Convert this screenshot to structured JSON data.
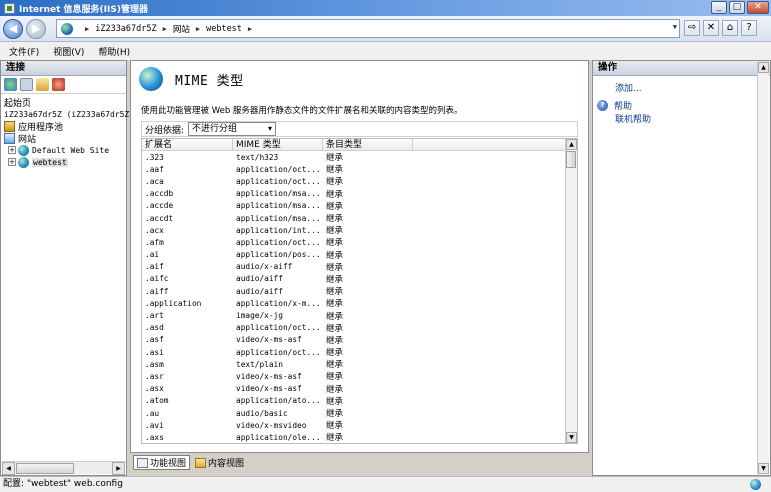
{
  "window": {
    "title": "Internet 信息服务(IIS)管理器"
  },
  "address": {
    "crumbs": [
      "iZ233a67dr5Z",
      "网站",
      "webtest"
    ]
  },
  "menu": {
    "items": [
      "文件(F)",
      "视图(V)",
      "帮助(H)"
    ]
  },
  "connections": {
    "header": "连接",
    "tree": {
      "start_page": "起始页",
      "server": "iZ233a67dr5Z (iZ233a67dr5Z\\",
      "app_pools": "应用程序池",
      "sites": "网站",
      "site1": "Default Web Site",
      "site2": "webtest"
    }
  },
  "main": {
    "title": "MIME 类型",
    "description": "使用此功能管理被 Web 服务器用作静态文件的文件扩展名和关联的内容类型的列表。",
    "group_label": "分组依据:",
    "group_value": "不进行分组",
    "columns": [
      "扩展名",
      "MIME 类型",
      "条目类型"
    ],
    "rows": [
      [
        ".323",
        "text/h323",
        "继承"
      ],
      [
        ".aaf",
        "application/oct...",
        "继承"
      ],
      [
        ".aca",
        "application/oct...",
        "继承"
      ],
      [
        ".accdb",
        "application/msa...",
        "继承"
      ],
      [
        ".accde",
        "application/msa...",
        "继承"
      ],
      [
        ".accdt",
        "application/msa...",
        "继承"
      ],
      [
        ".acx",
        "application/int...",
        "继承"
      ],
      [
        ".afm",
        "application/oct...",
        "继承"
      ],
      [
        ".ai",
        "application/pos...",
        "继承"
      ],
      [
        ".aif",
        "audio/x-aiff",
        "继承"
      ],
      [
        ".aifc",
        "audio/aiff",
        "继承"
      ],
      [
        ".aiff",
        "audio/aiff",
        "继承"
      ],
      [
        ".application",
        "application/x-m...",
        "继承"
      ],
      [
        ".art",
        "image/x-jg",
        "继承"
      ],
      [
        ".asd",
        "application/oct...",
        "继承"
      ],
      [
        ".asf",
        "video/x-ms-asf",
        "继承"
      ],
      [
        ".asi",
        "application/oct...",
        "继承"
      ],
      [
        ".asm",
        "text/plain",
        "继承"
      ],
      [
        ".asr",
        "video/x-ms-asf",
        "继承"
      ],
      [
        ".asx",
        "video/x-ms-asf",
        "继承"
      ],
      [
        ".atom",
        "application/ato...",
        "继承"
      ],
      [
        ".au",
        "audio/basic",
        "继承"
      ],
      [
        ".avi",
        "video/x-msvideo",
        "继承"
      ],
      [
        ".axs",
        "application/ole...",
        "继承"
      ]
    ]
  },
  "view_tabs": {
    "features": "功能视图",
    "content": "内容视图"
  },
  "actions": {
    "header": "操作",
    "add": "添加...",
    "help": "帮助",
    "online_help": "联机帮助"
  },
  "status": {
    "text": "配置: \"webtest\" web.config"
  }
}
